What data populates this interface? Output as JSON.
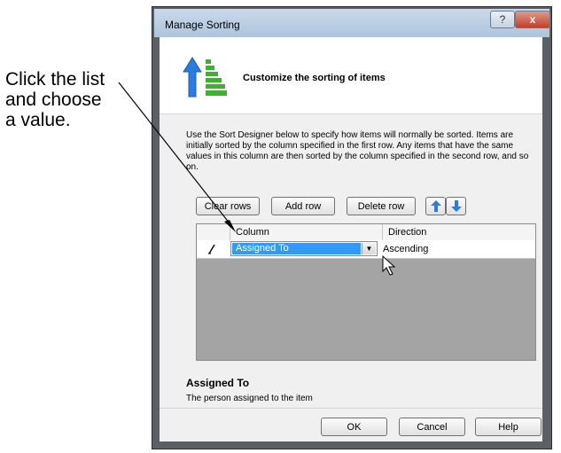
{
  "annotation": {
    "callout_lines": [
      "Click the list",
      "and choose",
      "a value."
    ]
  },
  "window": {
    "title": "Manage Sorting",
    "help_glyph": "?",
    "close_glyph": "x"
  },
  "header": {
    "title": "Customize the sorting of items"
  },
  "description": "Use the Sort Designer below to specify how items will normally be sorted. Items are initially sorted by the column specified in the first row. Any items that have the same values in this column are then sorted by the column specified in the second row, and so on.",
  "toolbar": {
    "clear_rows_label": "Clear rows",
    "add_row_label": "Add row",
    "delete_row_label": "Delete row",
    "move_up_icon": "arrow-up-icon",
    "move_down_icon": "arrow-down-icon"
  },
  "grid": {
    "columns": [
      "Column",
      "Direction"
    ],
    "rows": [
      {
        "indicator_icon": "pencil-icon",
        "column": "Assigned To",
        "direction": "Ascending"
      }
    ]
  },
  "info": {
    "title": "Assigned To",
    "text": "The person assigned to the item"
  },
  "footer": {
    "ok_label": "OK",
    "cancel_label": "Cancel",
    "help_label": "Help"
  },
  "colors": {
    "selection": "#3399ff",
    "grid_background": "#a4a4a4",
    "arrow_blue": "#2a7ddf",
    "bars_green": "#3fb02f"
  }
}
